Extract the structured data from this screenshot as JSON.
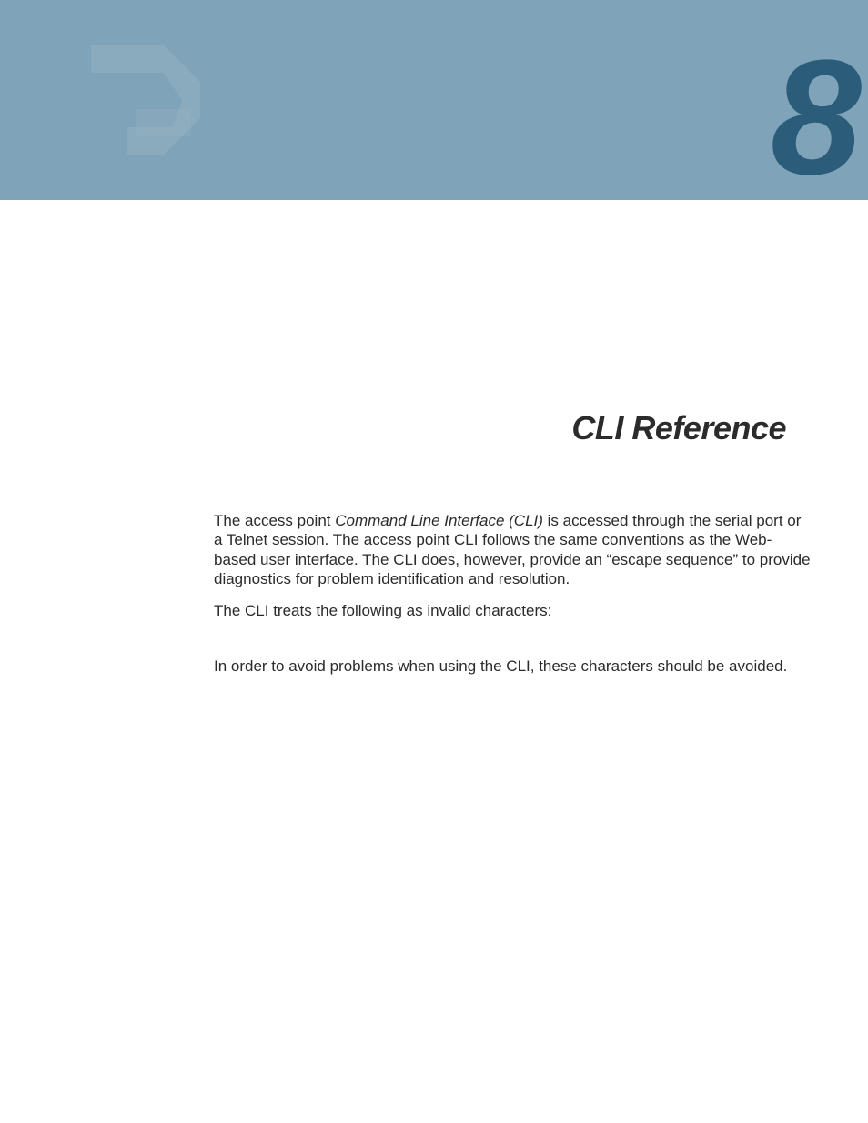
{
  "chapter": {
    "number": "8",
    "title": "CLI Reference"
  },
  "body": {
    "para1_pre": "The access point ",
    "para1_italic": "Command Line Interface (CLI)",
    "para1_post": " is accessed through the serial port or a Telnet session. The access point CLI follows the same conventions as the Web-based user interface. The CLI does, however, provide an “escape sequence” to provide diagnostics for problem identification and resolution.",
    "para2": "The CLI treats the following as invalid characters:",
    "para3": "In order to avoid problems when using the CLI, these characters should be avoided."
  }
}
